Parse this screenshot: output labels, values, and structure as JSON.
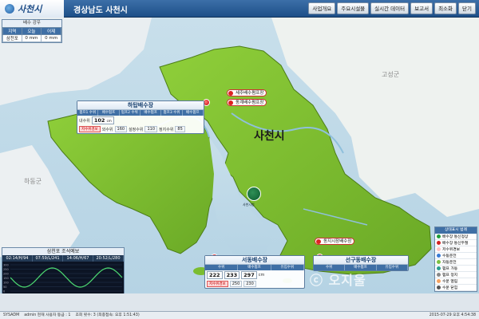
{
  "app": {
    "logo_text": "사천시",
    "region": "경상남도 사천시"
  },
  "menu": [
    {
      "label": "사업개요"
    },
    {
      "label": "주요시설물"
    },
    {
      "label": "실시간 데이터"
    },
    {
      "label": "보고서"
    },
    {
      "label": "최소화"
    },
    {
      "label": "닫기"
    }
  ],
  "rainfall": {
    "title": "배수 강우",
    "headers": [
      "지역",
      "오늘",
      "어제"
    ],
    "row": [
      "삼천포",
      "0 mm",
      "0 mm"
    ]
  },
  "map_labels": {
    "city": "사천시",
    "goseong": "고성군",
    "hadong": "하동군",
    "center_logo": "사천시청"
  },
  "facilities": {
    "hatap": {
      "title": "하탑배수장",
      "headers": [
        "펌프1 수위",
        "배수펌프",
        "펌프2 수위",
        "배수펌프",
        "펌프3 수위",
        "배수펌프"
      ],
      "water_level_label": "내수위",
      "water_level": "102",
      "unit": "cm",
      "alarm": "저수위경보",
      "sub1_label": "외수위",
      "sub1": "160",
      "sub2_label": "설정수위",
      "sub2": "110",
      "sub3_label": "정지수위",
      "sub3": "85"
    },
    "seodong": {
      "title": "서동배수장",
      "headers": [
        "수위",
        "배수펌프",
        "유입수위"
      ],
      "v1_label": "수위",
      "v1": "222",
      "v2": "233",
      "v3": "297",
      "unit": "cm",
      "alarm": "저수위경보",
      "sub1": "250",
      "sub2": "230"
    },
    "seongu": {
      "title": "선구동배수장",
      "headers": [
        "수위",
        "배수펌프",
        "유입수위"
      ]
    }
  },
  "tags": {
    "suju": "세주배수펌프장",
    "dongye": "동계배수펌프장",
    "dongji": "동지시장배수장"
  },
  "legend": {
    "title": "상태표시 범례",
    "items": [
      {
        "label": "배수장 통신정상",
        "color": "#1e9e3a"
      },
      {
        "label": "배수장 통신두절",
        "color": "#d22222"
      },
      {
        "label": "저수위경보",
        "color": "#ffc4c4"
      },
      {
        "label": "수동운전",
        "color": "#3a7bd5"
      },
      {
        "label": "자동운전",
        "color": "#7bc043"
      },
      {
        "label": "펌프 가동",
        "color": "#2a9d8f"
      },
      {
        "label": "펌프 정지",
        "color": "#888888"
      },
      {
        "label": "수문 열림",
        "color": "#f4a261"
      },
      {
        "label": "수문 닫힘",
        "color": "#555555"
      }
    ]
  },
  "tide": {
    "title": "삼천포 조석예보",
    "times": [
      "02:14/H/94",
      "07:59/L/241",
      "14:06/H/67",
      "20:52/L/280"
    ],
    "yaxis": [
      "300",
      "250",
      "200",
      "150",
      "100",
      "50",
      "0"
    ]
  },
  "status": {
    "user": "SYSADM",
    "text": "admin  현재 사용자 등급 : 1",
    "message": "조회 횟수: 3 (최종접속: 오후 1:51:43)",
    "datetime": "2015-07-29 오후 4:54:38"
  },
  "watermark": "ⓒ 오지울"
}
